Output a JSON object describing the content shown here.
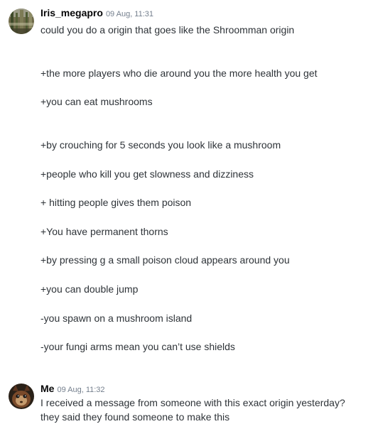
{
  "messages": [
    {
      "author": "Iris_megapro",
      "timestamp": "09 Aug, 11:31",
      "avatar_icon": "user-avatar-icon",
      "lines": [
        "could you do a origin that goes like the Shroomman origin",
        "+the more players who die around you the more health you get",
        "+you can eat mushrooms",
        "+by crouching for 5 seconds you look like a mushroom",
        "+people who kill you get slowness and dizziness",
        "+ hitting people gives them poison",
        "+You have permanent thorns",
        "+by pressing g a small poison cloud appears around you",
        "+you can double jump",
        "-you spawn on a mushroom island",
        "-your fungi arms mean you can’t use shields"
      ]
    },
    {
      "author": "Me",
      "timestamp": "09 Aug, 11:32",
      "avatar_icon": "user-avatar-icon",
      "lines": [
        "I received a message from someone with this exact origin yesterday?",
        "they said they found someone to make this"
      ]
    }
  ],
  "colors": {
    "username": "#060607",
    "timestamp": "#747f8d",
    "text": "#2e3338",
    "background": "#ffffff"
  }
}
